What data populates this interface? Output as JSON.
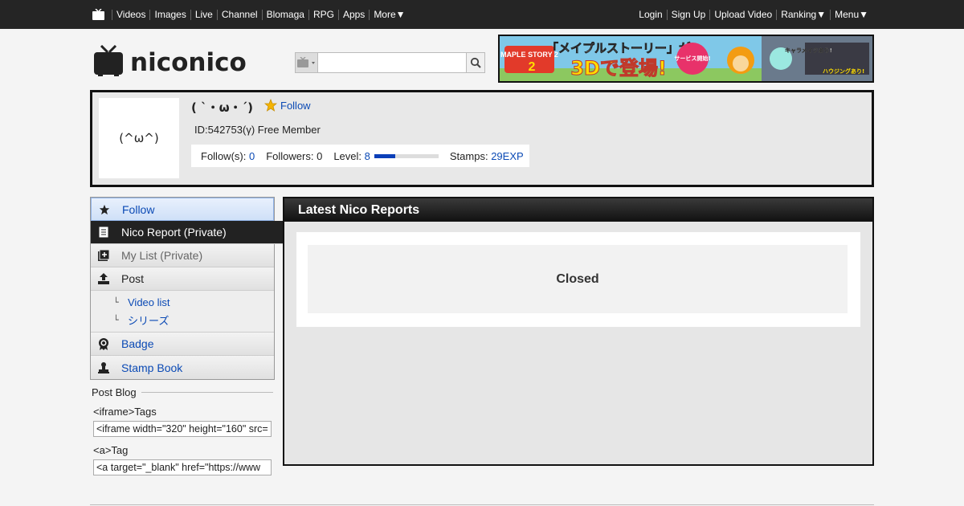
{
  "topbar": {
    "nav": [
      "Videos",
      "Images",
      "Live",
      "Channel",
      "Blomaga",
      "RPG",
      "Apps",
      "More▼"
    ],
    "login": "Login",
    "signup": "Sign Up",
    "upload": "Upload Video",
    "ranking": "Ranking▼",
    "menu": "Menu▼"
  },
  "header": {
    "logo_text": "niconico",
    "search_placeholder": ""
  },
  "banner": {
    "text_main": "「メイプルストーリー」が",
    "text_3d": "3Dで登場!",
    "badge_service": "サービス開始!",
    "tag_chara": "キャラメイクあり!",
    "tag_housing": "ハウジングあり!",
    "game_logo": "MAPLE STORY 2"
  },
  "profile": {
    "avatar_text": "(^ω^)",
    "nickname": "( `・ω・´)",
    "follow_label": "Follow",
    "id_line": "ID:542753(γ) Free Member",
    "follows_label": "Follow(s):",
    "follows_value": "0",
    "followers_label": "Followers:",
    "followers_value": "0",
    "level_label": "Level:",
    "level_value": "8",
    "level_progress": 0.33,
    "stamps_label": "Stamps:",
    "stamps_value": "29EXP"
  },
  "sidebar": {
    "items": [
      {
        "label": "Follow",
        "icon": "star-icon"
      },
      {
        "label": "Nico Report (Private)",
        "icon": "document-icon"
      },
      {
        "label": "My List (Private)",
        "icon": "mylist-icon"
      },
      {
        "label": "Post",
        "icon": "upload-icon"
      },
      {
        "label": "Badge",
        "icon": "badge-icon"
      },
      {
        "label": "Stamp Book",
        "icon": "stamp-icon"
      }
    ],
    "post_sub": [
      "Video list",
      "シリーズ"
    ]
  },
  "blog": {
    "title": "Post Blog",
    "iframe_label": "<iframe>Tags",
    "iframe_code": "<iframe width=\"320\" height=\"160\" src=",
    "a_label": "<a>Tag",
    "a_code": "<a target=\"_blank\" href=\"https://www"
  },
  "reports": {
    "title": "Latest Nico Reports",
    "status": "Closed"
  },
  "colors": {
    "topbar_bg": "#252525",
    "login": "#3fb8e8",
    "signup": "#f0a800",
    "link": "#0b4ab5"
  }
}
